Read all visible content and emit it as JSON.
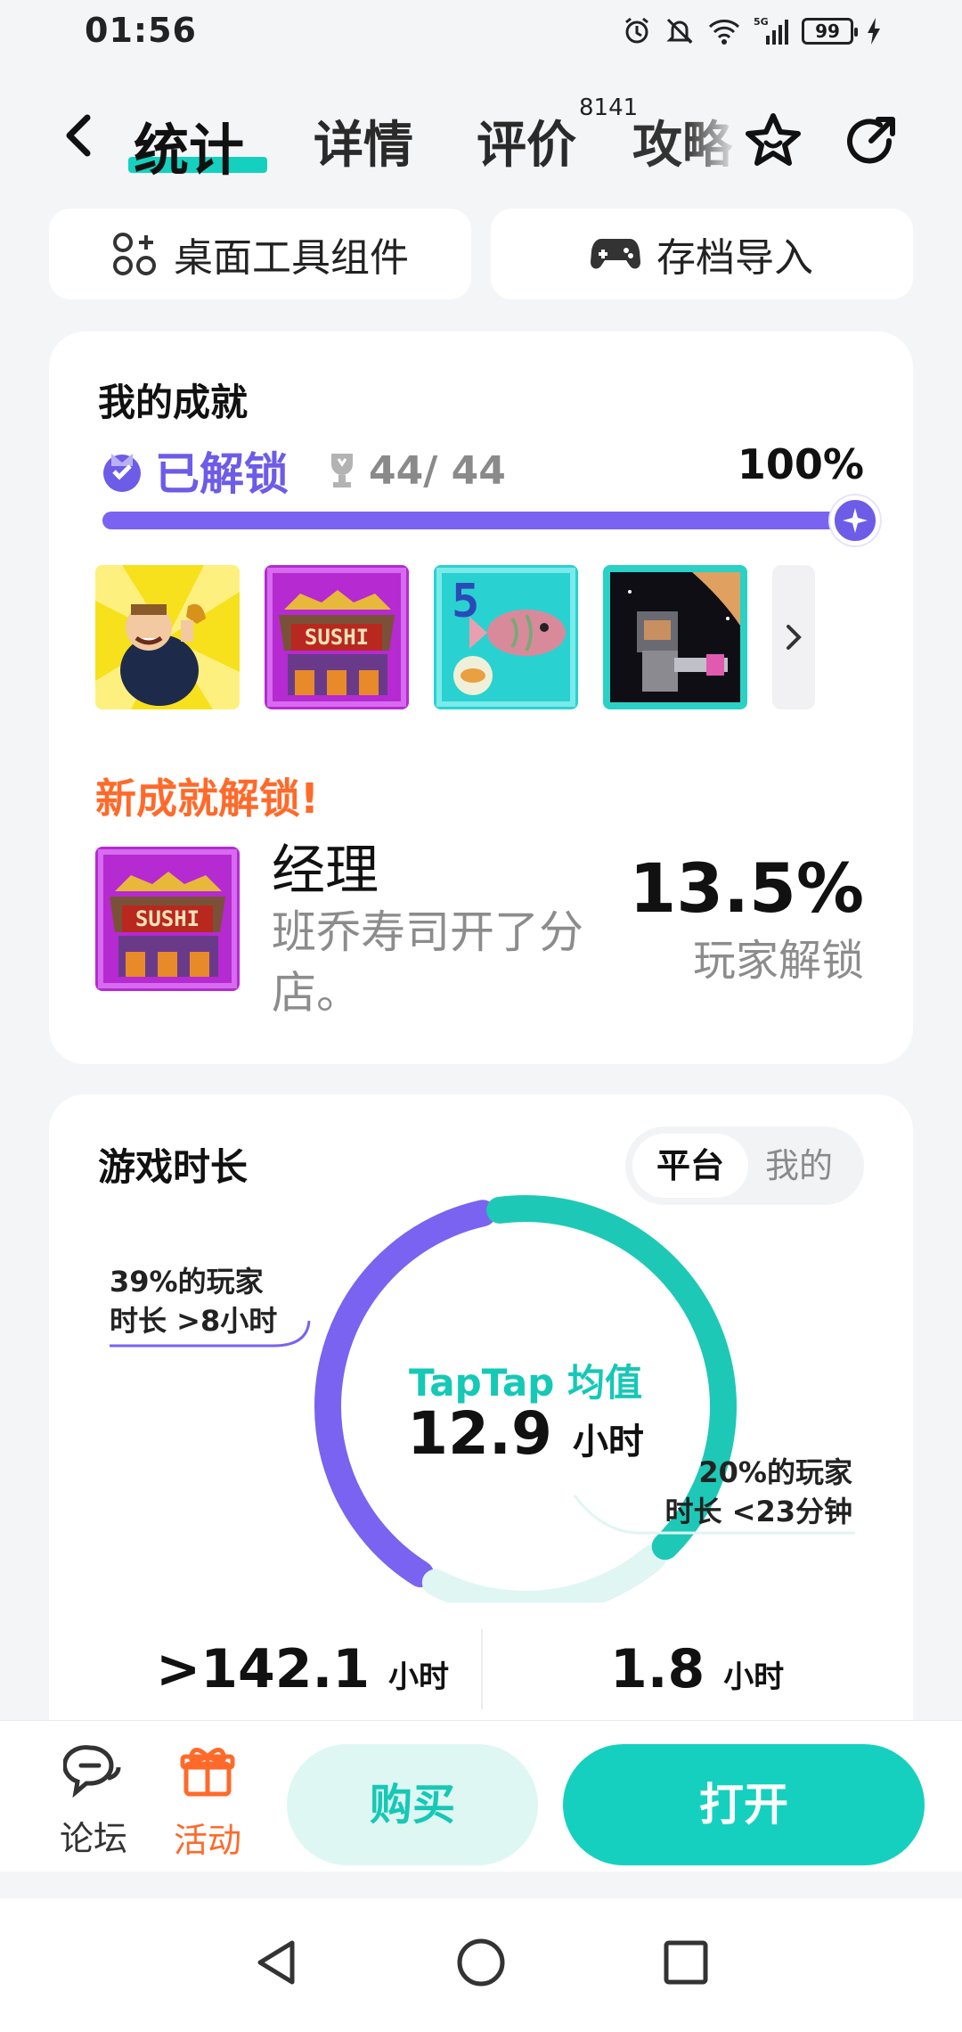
{
  "status_bar": {
    "time": "01:56",
    "battery": "99"
  },
  "header": {
    "tabs": [
      {
        "label": "统计"
      },
      {
        "label": "详情"
      },
      {
        "label": "评价"
      },
      {
        "label": "攻略"
      }
    ],
    "review_count": "8141"
  },
  "quick_actions": {
    "widget_label": "桌面工具组件",
    "save_import_label": "存档导入"
  },
  "achievements": {
    "title": "我的成就",
    "unlocked_label": "已解锁",
    "count": "44/ 44",
    "percent": "100%",
    "progress": 1.0,
    "new_unlock_label": "新成就解锁!",
    "new": {
      "name": "经理",
      "description": "班乔寿司开了分店。",
      "player_percent": "13.5%",
      "player_percent_label": "玩家解锁"
    }
  },
  "playtime": {
    "title": "游戏时长",
    "toggle": [
      "平台",
      "我的"
    ],
    "center_label": "TapTap 均值",
    "center_value": "12.9",
    "center_unit": "小时",
    "annot_left_line1": "39%的玩家",
    "annot_left_line2": "时长 >8小时",
    "annot_right_line1": "20%的玩家",
    "annot_right_line2": "时长 <23分钟",
    "bottom_left_prefix": ">",
    "bottom_left_value": "142.1",
    "bottom_left_unit": "小时",
    "bottom_right_value": "1.8",
    "bottom_right_unit": "小时"
  },
  "chart_data": {
    "type": "pie",
    "series": [
      {
        "name": "39%的玩家 时长 >8小时",
        "value": 39,
        "color": "#7a63f0"
      },
      {
        "value": 41,
        "color": "#1ec8b6"
      },
      {
        "name": "20%的玩家 时长 <23分钟",
        "value": 20,
        "color": "#dff6f3"
      }
    ]
  },
  "bottom_bar": {
    "forum": "论坛",
    "activity": "活动",
    "buy": "购买",
    "open": "打开"
  },
  "colors": {
    "accent": "#16d0bf",
    "purple": "#6c5ce7",
    "orange": "#ff6a2a"
  }
}
